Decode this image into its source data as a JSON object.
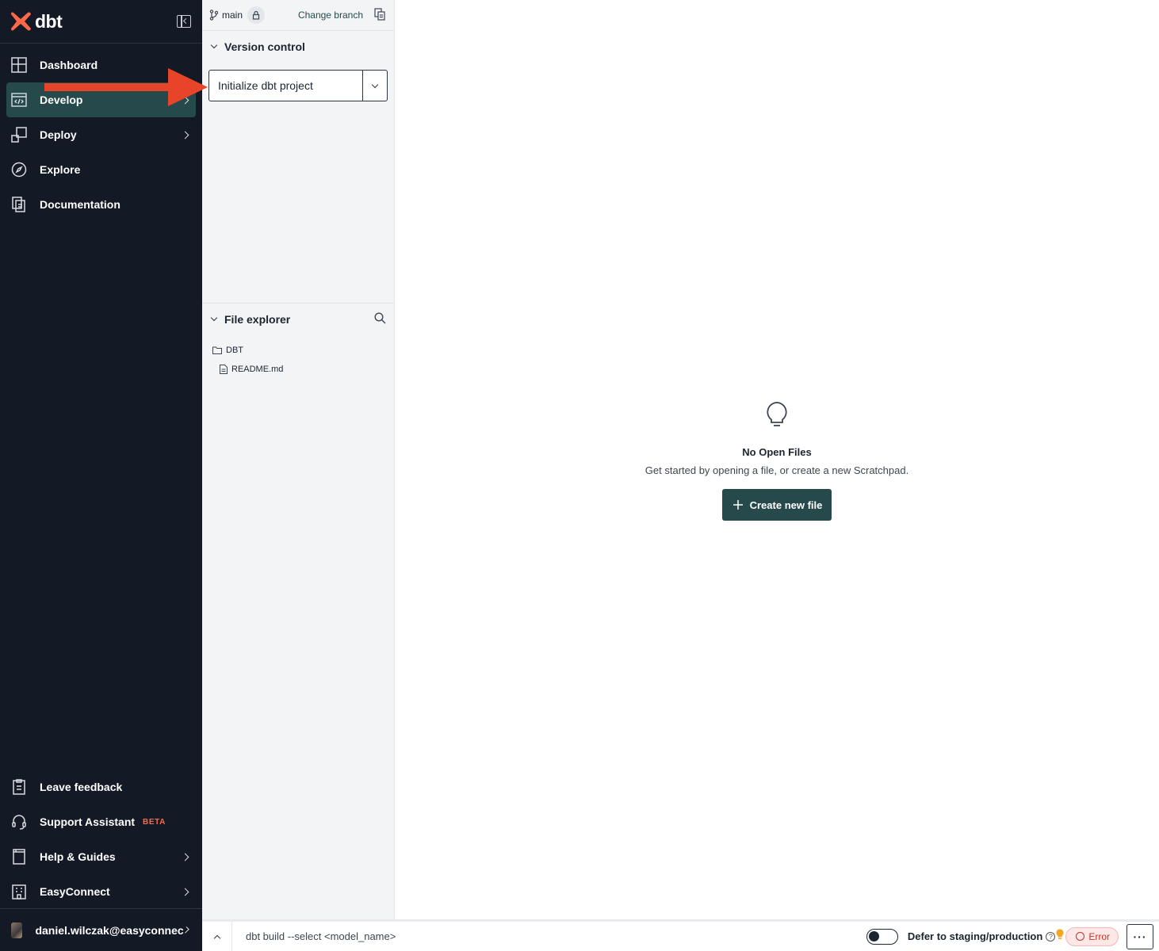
{
  "app": {
    "brand": "dbt"
  },
  "sidebar": {
    "items": [
      {
        "label": "Dashboard",
        "icon": "dashboard-icon"
      },
      {
        "label": "Develop",
        "icon": "code-icon",
        "active": true
      },
      {
        "label": "Deploy",
        "icon": "deploy-icon"
      },
      {
        "label": "Explore",
        "icon": "compass-icon"
      },
      {
        "label": "Documentation",
        "icon": "docs-icon"
      }
    ],
    "bottom_items": [
      {
        "label": "Leave feedback",
        "icon": "clipboard-icon"
      },
      {
        "label": "Support Assistant",
        "badge": "BETA",
        "icon": "headset-icon"
      },
      {
        "label": "Help & Guides",
        "icon": "book-icon"
      },
      {
        "label": "EasyConnect",
        "icon": "building-icon"
      }
    ],
    "user": {
      "name": "daniel.wilczak@easyconnec"
    }
  },
  "panel": {
    "branch": "main",
    "change_branch": "Change branch",
    "version_control": {
      "title": "Version control",
      "primary_action": "Initialize dbt project"
    },
    "file_explorer": {
      "title": "File explorer",
      "folder": "DBT",
      "files": [
        "README.md"
      ]
    }
  },
  "editor": {
    "empty_title": "No Open Files",
    "empty_desc": "Get started by opening a file, or create a new Scratchpad.",
    "create_button": "Create new file"
  },
  "bottom_bar": {
    "command_placeholder": "dbt build --select <model_name>",
    "defer_label": "Defer to staging/production",
    "status": "Error",
    "more": "···"
  },
  "colors": {
    "sidebar_bg": "#131a25",
    "accent": "#26494c",
    "brand_orange": "#ff694a",
    "annotation_arrow": "#e8442a",
    "error": "#c0332b"
  }
}
